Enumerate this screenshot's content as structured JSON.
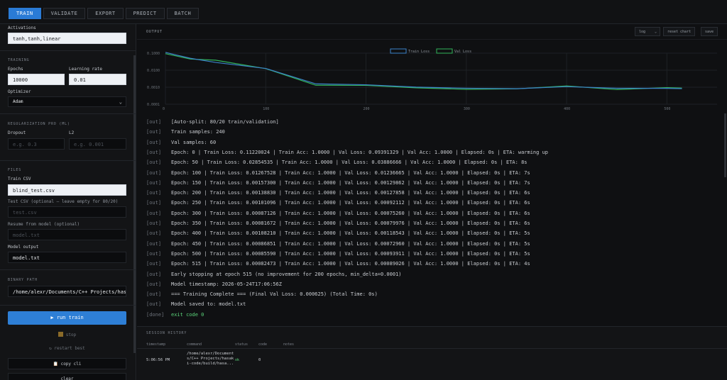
{
  "tabs": [
    "TRAIN",
    "VALIDATE",
    "EXPORT",
    "PREDICT",
    "BATCH"
  ],
  "sidebar": {
    "activations_label": "Activations",
    "activations_value": "tanh,tanh,linear",
    "training_section": "TRAINING",
    "epochs_label": "Epochs",
    "epochs_value": "10000",
    "lr_label": "Learning rate",
    "lr_value": "0.01",
    "optimizer_label": "Optimizer",
    "optimizer_value": "Adam",
    "reg_section": "REGULARIZATION PRO (ML)",
    "dropout_label": "Dropout",
    "dropout_placeholder": "e.g. 0.3",
    "l2_label": "L2",
    "l2_placeholder": "e.g. 0.001",
    "files_section": "FILES",
    "train_csv_label": "Train CSV",
    "train_csv_value": "blind_test.csv",
    "test_csv_label": "Test CSV (optional — leave empty for 80/20)",
    "test_csv_placeholder": "test.csv",
    "resume_label": "Resume from model (optional)",
    "resume_placeholder": "model.txt",
    "model_output_label": "Model output",
    "model_output_value": "model.txt",
    "binary_section": "BINARY PATH",
    "binary_value": "/home/alexr/Documents/C++ Projects/hasaki",
    "run_label": "▶ run train",
    "stop_label": "stop",
    "restart_label": "↻ restart best",
    "copy_cli_label": "📋 copy cli",
    "clear_label": "clear"
  },
  "output": {
    "title": "OUTPUT",
    "scale_select": "log",
    "reset_chart": "reset chart",
    "save": "save"
  },
  "chart_data": {
    "type": "line",
    "yscale": "log",
    "x": [
      0,
      10,
      25,
      50,
      100,
      150,
      200,
      250,
      300,
      350,
      400,
      450,
      500,
      515
    ],
    "series": [
      {
        "name": "Train Loss",
        "color": "#3b82c9",
        "values": [
          0.11220024,
          0.08,
          0.05,
          0.02854535,
          0.01267528,
          0.001573,
          0.0013883,
          0.00101096,
          0.00087126,
          0.00081672,
          0.0010821,
          0.00086851,
          0.0008559,
          0.00082473
        ]
      },
      {
        "name": "Val Loss",
        "color": "#31b35b",
        "values": [
          0.09391329,
          0.07,
          0.045,
          0.03886666,
          0.01236665,
          0.00129862,
          0.00127858,
          0.00092112,
          0.0007526,
          0.00079976,
          0.00118543,
          0.0007296,
          0.00093911,
          0.00089026
        ]
      }
    ],
    "xticks": [
      "0",
      "100",
      "200",
      "300",
      "400",
      "500"
    ],
    "yticks": [
      "0.1000",
      "0.0100",
      "0.0010",
      "0.0001"
    ],
    "legend": "top-center",
    "grid": true
  },
  "log": [
    {
      "tag": "[out]",
      "msg": "[Auto-split: 80/20 train/validation]"
    },
    {
      "tag": "[out]",
      "msg": "Train samples: 240"
    },
    {
      "tag": "[out]",
      "msg": "Val samples: 60"
    },
    {
      "tag": "[out]",
      "msg": "Epoch: 0 | Train Loss: 0.11220024 | Train Acc: 1.0000 | Val Loss: 0.09391329 | Val Acc: 1.0000 | Elapsed: 0s | ETA: warming up"
    },
    {
      "tag": "[out]",
      "msg": "Epoch: 50 | Train Loss: 0.02854535 | Train Acc: 1.0000 | Val Loss: 0.03886666 | Val Acc: 1.0000 | Elapsed: 0s | ETA: 8s"
    },
    {
      "tag": "[out]",
      "msg": "Epoch: 100 | Train Loss: 0.01267528 | Train Acc: 1.0000 | Val Loss: 0.01236665 | Val Acc: 1.0000 | Elapsed: 0s | ETA: 7s"
    },
    {
      "tag": "[out]",
      "msg": "Epoch: 150 | Train Loss: 0.00157300 | Train Acc: 1.0000 | Val Loss: 0.00129862 | Val Acc: 1.0000 | Elapsed: 0s | ETA: 7s"
    },
    {
      "tag": "[out]",
      "msg": "Epoch: 200 | Train Loss: 0.00138830 | Train Acc: 1.0000 | Val Loss: 0.00127858 | Val Acc: 1.0000 | Elapsed: 0s | ETA: 6s"
    },
    {
      "tag": "[out]",
      "msg": "Epoch: 250 | Train Loss: 0.00101096 | Train Acc: 1.0000 | Val Loss: 0.00092112 | Val Acc: 1.0000 | Elapsed: 0s | ETA: 6s"
    },
    {
      "tag": "[out]",
      "msg": "Epoch: 300 | Train Loss: 0.00087126 | Train Acc: 1.0000 | Val Loss: 0.00075260 | Val Acc: 1.0000 | Elapsed: 0s | ETA: 6s"
    },
    {
      "tag": "[out]",
      "msg": "Epoch: 350 | Train Loss: 0.00081672 | Train Acc: 1.0000 | Val Loss: 0.00079976 | Val Acc: 1.0000 | Elapsed: 0s | ETA: 6s"
    },
    {
      "tag": "[out]",
      "msg": "Epoch: 400 | Train Loss: 0.00108210 | Train Acc: 1.0000 | Val Loss: 0.00118543 | Val Acc: 1.0000 | Elapsed: 0s | ETA: 5s"
    },
    {
      "tag": "[out]",
      "msg": "Epoch: 450 | Train Loss: 0.00086851 | Train Acc: 1.0000 | Val Loss: 0.00072960 | Val Acc: 1.0000 | Elapsed: 0s | ETA: 5s"
    },
    {
      "tag": "[out]",
      "msg": "Epoch: 500 | Train Loss: 0.00085590 | Train Acc: 1.0000 | Val Loss: 0.00093911 | Val Acc: 1.0000 | Elapsed: 0s | ETA: 5s"
    },
    {
      "tag": "[out]",
      "msg": "Epoch: 515 | Train Loss: 0.00082473 | Train Acc: 1.0000 | Val Loss: 0.00089026 | Val Acc: 1.0000 | Elapsed: 0s | ETA: 4s"
    },
    {
      "tag": "[out]",
      "msg": "Early stopping at epoch 515 (no improvement for 200 epochs, min_delta=0.0001)"
    },
    {
      "tag": "[out]",
      "msg": "Model timestamp: 2026-05-24T17:06:56Z"
    },
    {
      "tag": "[out]",
      "msg": "=== Training Complete === (Final Val Loss: 0.000625) (Total Time: 0s)"
    },
    {
      "tag": "[out]",
      "msg": "Model saved to: model.txt"
    },
    {
      "tag": "[done]",
      "msg": "exit code 0",
      "ok": true
    }
  ],
  "history": {
    "title": "SESSION HISTORY",
    "headers": [
      "timestamp",
      "command",
      "status",
      "code",
      "notes"
    ],
    "rows": [
      {
        "timestamp": "5:06:56 PM",
        "command": "/home/alexr/Documents/C++ Projects/hasaki-code/build/hasa...",
        "status": "ok",
        "code": "0",
        "notes": ""
      }
    ]
  }
}
